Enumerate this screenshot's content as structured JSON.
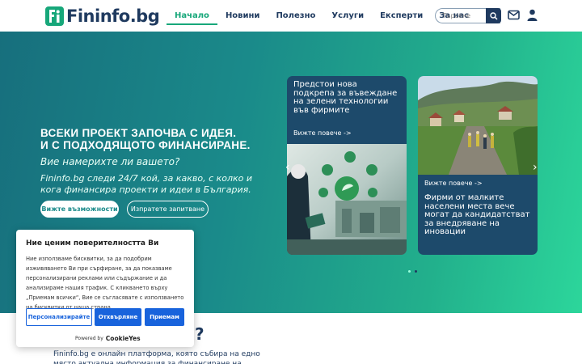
{
  "header": {
    "logo_text": "Fininfo.bg",
    "nav": [
      {
        "label": "Начало",
        "active": true
      },
      {
        "label": "Новини",
        "active": false
      },
      {
        "label": "Полезно",
        "active": false
      },
      {
        "label": "Услуги",
        "active": false
      },
      {
        "label": "Експерти",
        "active": false
      },
      {
        "label": "За нас",
        "active": false
      }
    ],
    "search_placeholder": "Търсене",
    "icons": [
      "search-icon",
      "mail-icon",
      "user-icon"
    ]
  },
  "hero": {
    "title_line1": "ВСЕКИ ПРОЕКТ ЗАПОЧВА С ИДЕЯ.",
    "title_line2": "И С ПОДХОДЯЩОТО ФИНАНСИРАНЕ.",
    "subtitle": "Вие намерихте ли вашето?",
    "description": "Fininfo.bg следи 24/7 кой, за какво, с колко и кога финансира проекти и идеи в България.",
    "btn_primary": "Вижте възможности",
    "btn_secondary": "Изпратете запитване",
    "cards": [
      {
        "title": "Предстои нова подкрепа за въвеждане на зелени технологии във фирмите",
        "more": "Вижте повече ->"
      },
      {
        "title": "Фирми от малките населени места вече могат да кандидатстват за внедряване на иновации",
        "more": "Вижте повече ->"
      }
    ],
    "arrow_left": "‹",
    "arrow_right": "›"
  },
  "below": {
    "question_mark": "?",
    "text": "Fininfo.bg е онлайн платформа, която събира на едно място актуална информация за финансиране на проекти и инициативи на:"
  },
  "cookie": {
    "title": "Ние ценим поверителността Ви",
    "text": "Ние използваме бисквитки, за да подобрим изживяването Ви при сърфиране, за да показваме персонализирани реклами или съдържание и да анализираме нашия трафик. С кликването върху „Приемам всички“, Вие се съгласявате с използването на бисквитки от наша страна.",
    "btn_customize": "Персонализирайте",
    "btn_reject": "Отхвърляне",
    "btn_accept": "Приемам",
    "powered_by": "Powered by",
    "powered_brand": "CookieYes"
  },
  "colors": {
    "brand_green": "#17a77a",
    "navy": "#1f3a5f",
    "cookie_blue": "#1863dc"
  }
}
